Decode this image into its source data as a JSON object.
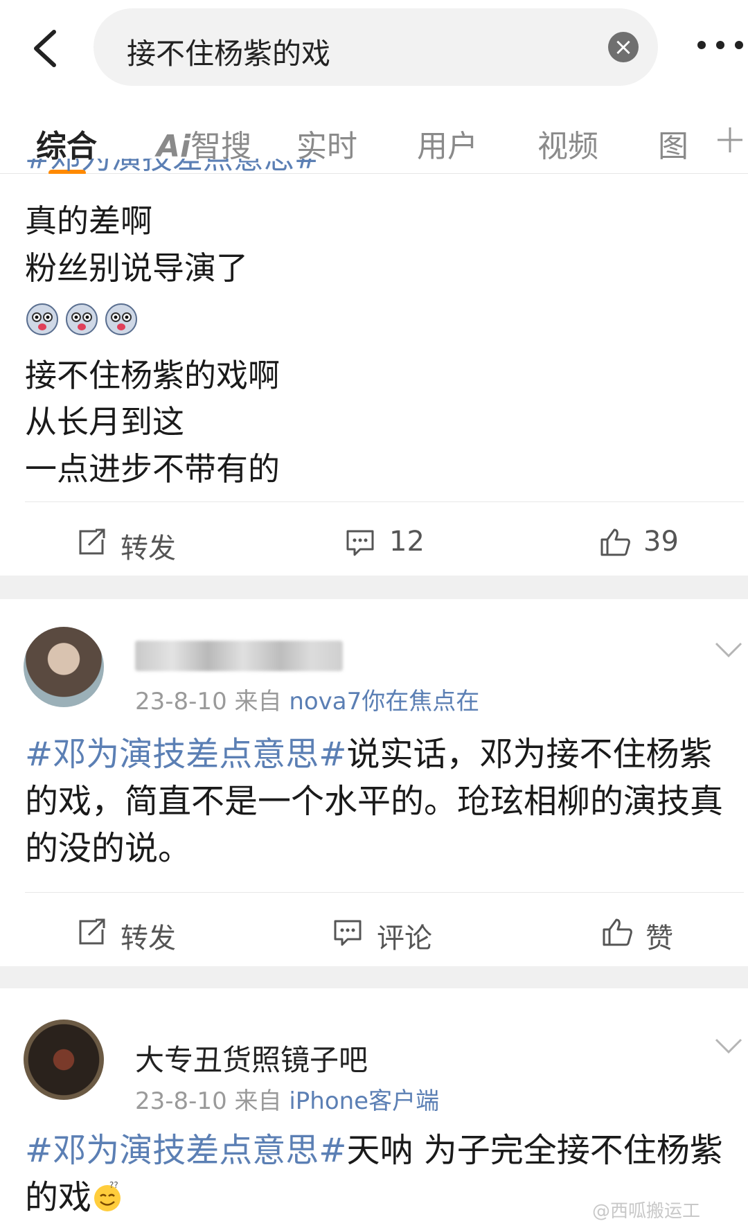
{
  "search": {
    "query": "接不住杨紫的戏"
  },
  "tabs": [
    {
      "label": "综合",
      "active": true
    },
    {
      "label_ai": "Ai",
      "label_rest": "智搜"
    },
    {
      "label": "实时"
    },
    {
      "label": "用户"
    },
    {
      "label": "视频"
    },
    {
      "label": "图"
    }
  ],
  "colors": {
    "accent": "#ff8a00",
    "link": "#5b7fb4",
    "text": "#1a1a1a",
    "meta": "#9a9a9a",
    "background": "#f0f0f0"
  },
  "post1": {
    "cut_tag": "#邓为演技差点意思#",
    "lines": [
      "真的差啊",
      "粉丝别说导演了",
      "接不住杨紫的戏啊",
      "从长月到这",
      "一点进步不带有的"
    ],
    "emoji_icon": "dog-emoji-icon",
    "actions": {
      "repost": "转发",
      "comments": "12",
      "likes": "39"
    }
  },
  "post2": {
    "date": "23-8-10",
    "from_label": "来自",
    "source": "nova7你在焦点在",
    "tag": "#邓为演技差点意思#",
    "text": "说实话，邓为接不住杨紫的戏，简直不是一个水平的。玱玹相柳的演技真的没的说。",
    "actions": {
      "repost": "转发",
      "comment": "评论",
      "like": "赞"
    }
  },
  "post3": {
    "author": "大专丑货照镜子吧",
    "date": "23-8-10",
    "from_label": "来自",
    "source": "iPhone客户端",
    "tag": "#邓为演技差点意思#",
    "text": "天呐 为子完全接不住杨紫的戏"
  },
  "watermark": "@西呱搬运工"
}
